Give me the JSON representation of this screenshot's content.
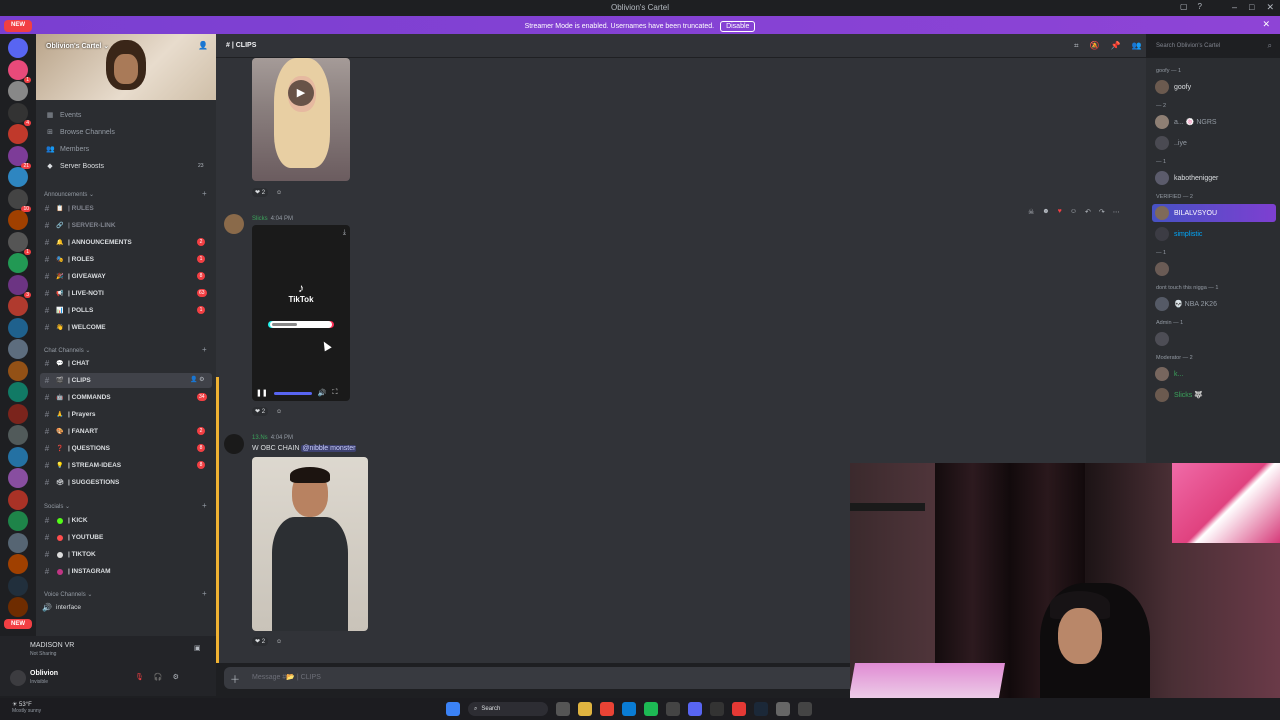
{
  "window": {
    "title": "Oblivion's Cartel"
  },
  "banner": {
    "text": "Streamer Mode is enabled. Usernames have been truncated.",
    "disable_label": "Disable"
  },
  "server": {
    "name": "Oblivion's Cartel"
  },
  "guild_list": {
    "new_label_top": "NEW",
    "new_label_bottom": "NEW",
    "badges": [
      "1",
      "4",
      "21",
      "10",
      "1",
      "3",
      "1",
      "4",
      "11",
      "101",
      "374",
      "13"
    ]
  },
  "sidebar_nav": [
    {
      "label": "Events",
      "icon": "calendar-icon"
    },
    {
      "label": "Browse Channels",
      "icon": "browse-icon"
    },
    {
      "label": "Members",
      "icon": "members-icon"
    },
    {
      "label": "Server Boosts",
      "icon": "boost-icon",
      "count": "23"
    }
  ],
  "categories": {
    "announcements": "Announcements",
    "chat": "Chat Channels",
    "socials": "Socials",
    "voice": "Voice Channels"
  },
  "channels_announcements": [
    {
      "label": "| RULES",
      "emoji": "📋",
      "muted": true
    },
    {
      "label": "| SERVER-LINK",
      "emoji": "🔗",
      "muted": true
    },
    {
      "label": "| ANNOUNCEMENTS",
      "emoji": "🔔",
      "badge": "2"
    },
    {
      "label": "| ROLES",
      "emoji": "🎭",
      "badge": "1"
    },
    {
      "label": "| GIVEAWAY",
      "emoji": "🎉",
      "badge": "8"
    },
    {
      "label": "| LIVE-NOTI",
      "emoji": "📢",
      "badge": "63"
    },
    {
      "label": "| POLLS",
      "emoji": "📊",
      "badge": "1"
    },
    {
      "label": "| WELCOME",
      "emoji": "👋"
    }
  ],
  "channels_chat": [
    {
      "label": "| CHAT",
      "emoji": "💬"
    },
    {
      "label": "| CLIPS",
      "emoji": "🎬",
      "active": true
    },
    {
      "label": "| COMMANDS",
      "emoji": "🤖",
      "badge": "34"
    },
    {
      "label": "| Prayers",
      "emoji": "🙏"
    },
    {
      "label": "| FANART",
      "emoji": "🎨",
      "badge": "2"
    },
    {
      "label": "| QUESTIONS",
      "emoji": "❓",
      "badge": "8"
    },
    {
      "label": "| STREAM-IDEAS",
      "emoji": "💡",
      "badge": "8"
    },
    {
      "label": "| SUGGESTIONS",
      "emoji": "🗳"
    }
  ],
  "channels_socials": [
    {
      "label": "| KICK",
      "dot": "#53fc18"
    },
    {
      "label": "| YOUTUBE",
      "dot": "#ff4d4d"
    },
    {
      "label": "| TIKTOK",
      "dot": "#dddddd"
    },
    {
      "label": "| INSTAGRAM",
      "dot": "#c13584"
    }
  ],
  "voice_channel": {
    "label": "interface"
  },
  "voice_status": {
    "title": "MADISON VR",
    "subtitle": "Not Sharing"
  },
  "user": {
    "name": "Oblivion",
    "status": "Invisible"
  },
  "channel": {
    "name": "| CLIPS",
    "search_placeholder": "Search Oblivion's Cartel"
  },
  "messages": [
    {
      "reaction_count": "2"
    },
    {
      "author": "Slicks",
      "time": "4:04 PM",
      "reaction_count": "2",
      "embed_title": "TikTok"
    },
    {
      "author": "13.Ns",
      "time": "4:04 PM",
      "text": "W OBC CHAIN",
      "mention": "@nibble monster",
      "reaction_count": "2"
    }
  ],
  "composer": {
    "placeholder": "Message #📂 | CLIPS"
  },
  "members": {
    "groups": [
      {
        "label": "goofy — 1",
        "members": [
          {
            "name": "goofy",
            "color": "#dbdee1"
          }
        ]
      },
      {
        "label": "— 2",
        "members": [
          {
            "name": "a... 🍥 NGRS",
            "color": "#949ba4"
          },
          {
            "name": "..iye",
            "color": "#949ba4"
          }
        ]
      },
      {
        "label": "— 1",
        "members": [
          {
            "name": "kabothenigger",
            "color": "#dbdee1"
          }
        ]
      },
      {
        "label": "VERIFIED — 2",
        "members": [
          {
            "name": "BILALVSYOU",
            "color": "#ffffff",
            "highlight": true
          },
          {
            "name": "simplistic",
            "color": "#00a8fc"
          }
        ]
      },
      {
        "label": "— 1",
        "members": [
          {
            "name": "",
            "color": "#949ba4"
          }
        ]
      },
      {
        "label": "dont touch this nigga — 1",
        "members": [
          {
            "name": "💀 NBA 2K26",
            "color": "#949ba4"
          }
        ]
      },
      {
        "label": "Admin — 1",
        "members": [
          {
            "name": "",
            "color": "#f47fff"
          }
        ]
      },
      {
        "label": "Moderator — 2",
        "members": [
          {
            "name": "k...",
            "color": "#3ba55c"
          },
          {
            "name": "Slicks 🐺",
            "color": "#3ba55c"
          }
        ]
      }
    ]
  },
  "taskbar": {
    "weather_temp": "53°F",
    "weather_desc": "Mostly sunny",
    "search_label": "Search"
  },
  "colors": {
    "accent": "#5865f2",
    "banner": "#8e44d6",
    "danger": "#f23f43",
    "bg": "#313338"
  }
}
